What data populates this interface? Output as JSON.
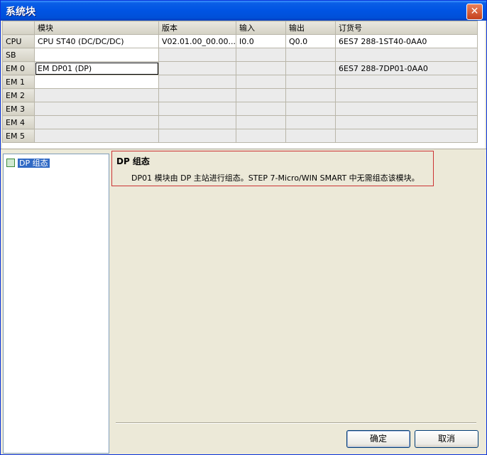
{
  "window": {
    "title": "系统块",
    "close_glyph": "✕"
  },
  "grid": {
    "headers": [
      "",
      "模块",
      "版本",
      "输入",
      "输出",
      "订货号"
    ],
    "rows": [
      {
        "slot": "CPU",
        "module": "CPU ST40 (DC/DC/DC)",
        "version": "V02.01.00_00.00...",
        "input": "I0.0",
        "output": "Q0.0",
        "order": "6ES7 288-1ST40-0AA0"
      },
      {
        "slot": "SB",
        "module": "",
        "version": "",
        "input": "",
        "output": "",
        "order": ""
      },
      {
        "slot": "EM 0",
        "module": "EM DP01 (DP)",
        "version": "",
        "input": "",
        "output": "",
        "order": "6ES7 288-7DP01-0AA0"
      },
      {
        "slot": "EM 1",
        "module": "",
        "version": "",
        "input": "",
        "output": "",
        "order": ""
      },
      {
        "slot": "EM 2",
        "module": "",
        "version": "",
        "input": "",
        "output": "",
        "order": ""
      },
      {
        "slot": "EM 3",
        "module": "",
        "version": "",
        "input": "",
        "output": "",
        "order": ""
      },
      {
        "slot": "EM 4",
        "module": "",
        "version": "",
        "input": "",
        "output": "",
        "order": ""
      },
      {
        "slot": "EM 5",
        "module": "",
        "version": "",
        "input": "",
        "output": "",
        "order": ""
      }
    ]
  },
  "tree": {
    "items": [
      {
        "label": "DP 组态",
        "icon": "module-node-icon"
      }
    ]
  },
  "info": {
    "title": "DP 组态",
    "description": "DP01 模块由 DP 主站进行组态。STEP 7-Micro/WIN SMART 中无需组态该模块。"
  },
  "buttons": {
    "ok": "确定",
    "cancel": "取消"
  }
}
